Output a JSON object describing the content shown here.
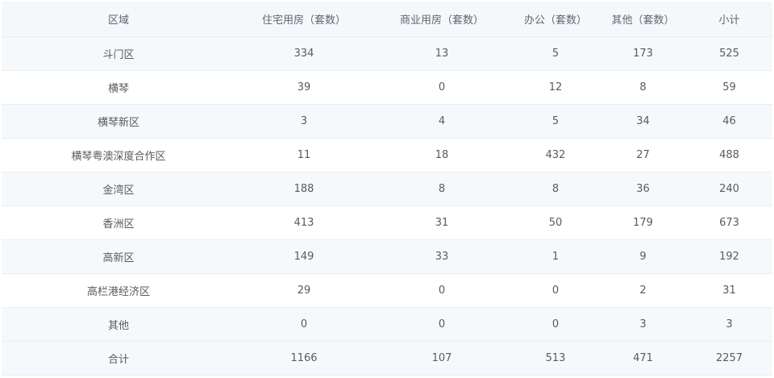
{
  "table": {
    "columns": [
      "区域",
      "住宅用房（套数）",
      "商业用房（套数）",
      "办公（套数）",
      "其他（套数）",
      "小计"
    ],
    "rows": [
      [
        "斗门区",
        "334",
        "13",
        "5",
        "173",
        "525"
      ],
      [
        "横琴",
        "39",
        "0",
        "12",
        "8",
        "59"
      ],
      [
        "横琴新区",
        "3",
        "4",
        "5",
        "34",
        "46"
      ],
      [
        "横琴粤澳深度合作区",
        "11",
        "18",
        "432",
        "27",
        "488"
      ],
      [
        "金湾区",
        "188",
        "8",
        "8",
        "36",
        "240"
      ],
      [
        "香洲区",
        "413",
        "31",
        "50",
        "179",
        "673"
      ],
      [
        "高新区",
        "149",
        "33",
        "1",
        "9",
        "192"
      ],
      [
        "高栏港经济区",
        "29",
        "0",
        "0",
        "2",
        "31"
      ],
      [
        "其他",
        "0",
        "0",
        "0",
        "3",
        "3"
      ],
      [
        "合计",
        "1166",
        "107",
        "513",
        "471",
        "2257"
      ]
    ]
  },
  "colors": {
    "header_bg": "#f5f8fb",
    "stripe_bg": "#f6f9fc",
    "row_bg": "#ffffff",
    "border": "#e9eef4",
    "text": "#5a5a5a"
  }
}
